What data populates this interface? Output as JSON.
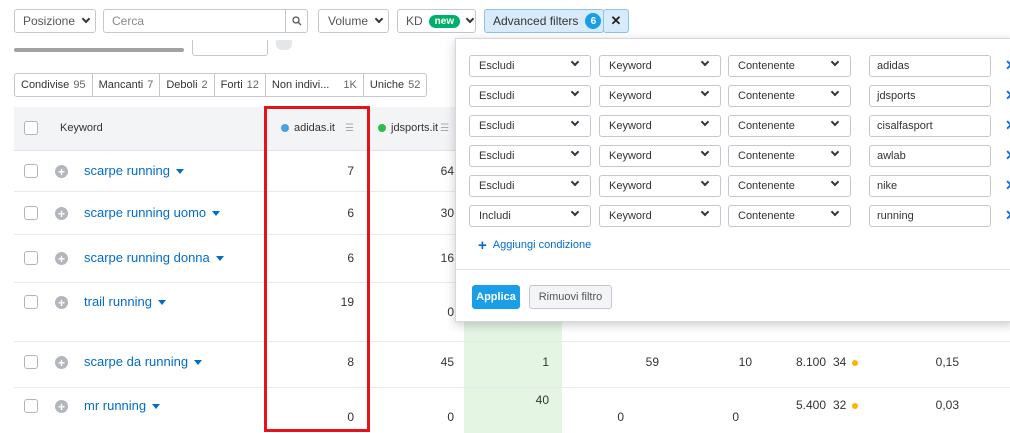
{
  "toolbar": {
    "position_label": "Posizione",
    "search_placeholder": "Cerca",
    "volume_label": "Volume",
    "kd_label": "KD",
    "kd_badge": "new",
    "advanced_filters_label": "Advanced filters",
    "advanced_filters_count": "6"
  },
  "tabs": [
    {
      "label": "Condivise",
      "count": "95"
    },
    {
      "label": "Mancanti",
      "count": "7"
    },
    {
      "label": "Deboli",
      "count": "2"
    },
    {
      "label": "Forti",
      "count": "12"
    },
    {
      "label": "Non indivi...",
      "count": "1K"
    },
    {
      "label": "Uniche",
      "count": "52"
    }
  ],
  "table": {
    "col_keyword": "Keyword",
    "col_domain1": "adidas.it",
    "col_domain2": "jdsports.it",
    "domain1_color": "#4a9fe8",
    "domain2_color": "#2bbf4a",
    "rows": [
      {
        "keyword": "scarpe running",
        "adidas": "7",
        "jdsports": "64"
      },
      {
        "keyword": "scarpe running uomo",
        "adidas": "6",
        "jdsports": "30"
      },
      {
        "keyword": "scarpe running donna",
        "adidas": "6",
        "jdsports": "16"
      },
      {
        "keyword": "trail running",
        "adidas": "19",
        "jdsports": "0"
      },
      {
        "keyword": "scarpe da running",
        "adidas": "8",
        "jdsports": "45",
        "c3": "1",
        "c4": "59",
        "c5": "10",
        "volume": "8.100",
        "kd": "34",
        "cpc": "0,15"
      },
      {
        "keyword": "mr running",
        "adidas": "0",
        "jdsports": "0",
        "c3": "40",
        "c4": "0",
        "c5": "0",
        "volume": "5.400",
        "kd": "32",
        "cpc": "0,03"
      }
    ]
  },
  "filters": {
    "rows": [
      {
        "mode": "Escludi",
        "field": "Keyword",
        "op": "Contenente",
        "value": "adidas"
      },
      {
        "mode": "Escludi",
        "field": "Keyword",
        "op": "Contenente",
        "value": "jdsports"
      },
      {
        "mode": "Escludi",
        "field": "Keyword",
        "op": "Contenente",
        "value": "cisalfasport"
      },
      {
        "mode": "Escludi",
        "field": "Keyword",
        "op": "Contenente",
        "value": "awlab"
      },
      {
        "mode": "Escludi",
        "field": "Keyword",
        "op": "Contenente",
        "value": "nike"
      },
      {
        "mode": "Includi",
        "field": "Keyword",
        "op": "Contenente",
        "value": "running"
      }
    ],
    "add_condition": "Aggiungi condizione",
    "apply": "Applica",
    "remove": "Rimuovi filtro"
  },
  "colors": {
    "accent": "#1b9ee8",
    "link": "#006dca",
    "highlight_box": "#e3121b",
    "kd_dot": "#f5b800",
    "green_cell": "#e4f5e4"
  }
}
